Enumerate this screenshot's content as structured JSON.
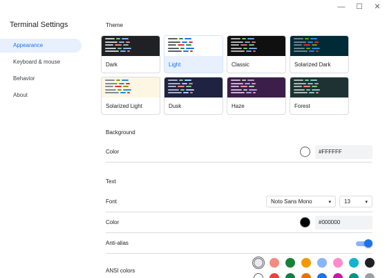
{
  "window": {
    "minimize_glyph": "—",
    "maximize_glyph": "☐",
    "close_glyph": "✕"
  },
  "sidebar": {
    "title": "Terminal Settings",
    "items": [
      {
        "label": "Appearance",
        "active": true
      },
      {
        "label": "Keyboard & mouse",
        "active": false
      },
      {
        "label": "Behavior",
        "active": false
      },
      {
        "label": "About",
        "active": false
      }
    ]
  },
  "theme": {
    "section_title": "Theme",
    "selected": "Light",
    "cards": [
      {
        "label": "Dark",
        "bg": "#202124",
        "fg": "#e8eaed",
        "accents": [
          "#f28b82",
          "#81c995",
          "#8ab4f8"
        ]
      },
      {
        "label": "Light",
        "bg": "#ffffff",
        "fg": "#3c4043",
        "accents": [
          "#d93025",
          "#1e8e3e",
          "#1a73e8"
        ]
      },
      {
        "label": "Classic",
        "bg": "#101010",
        "fg": "#d0d0d0",
        "accents": [
          "#e06c75",
          "#6fcf6f",
          "#6fa8dc"
        ]
      },
      {
        "label": "Solarized Dark",
        "bg": "#002b36",
        "fg": "#839496",
        "accents": [
          "#dc322f",
          "#859900",
          "#268bd2"
        ]
      },
      {
        "label": "Solarized Light",
        "bg": "#fdf6e3",
        "fg": "#657b83",
        "accents": [
          "#dc322f",
          "#859900",
          "#268bd2"
        ]
      },
      {
        "label": "Dusk",
        "bg": "#1f2240",
        "fg": "#c7c9e0",
        "accents": [
          "#f28b82",
          "#81c995",
          "#aecbfa"
        ]
      },
      {
        "label": "Haze",
        "bg": "#3c1e4a",
        "fg": "#e0d0ea",
        "accents": [
          "#f48fb1",
          "#a5d6a7",
          "#b39ddb"
        ]
      },
      {
        "label": "Forest",
        "bg": "#1e3233",
        "fg": "#c5d6d0",
        "accents": [
          "#f28b82",
          "#81c995",
          "#80cbc4"
        ]
      }
    ]
  },
  "background": {
    "section_title": "Background",
    "color_label": "Color",
    "color_value": "#FFFFFF",
    "swatch": "#ffffff"
  },
  "text": {
    "section_title": "Text",
    "font_label": "Font",
    "font_value": "Noto Sans Mono",
    "font_size": "13",
    "color_label": "Color",
    "color_value": "#000000",
    "swatch": "#000000",
    "antialias_label": "Anti-alias",
    "antialias_on": true,
    "ansi_label": "ANSI colors",
    "ansi_row1": [
      "#e8eaed",
      "#f28b82",
      "#188038",
      "#f29900",
      "#8ab4f8",
      "#ff8bcb",
      "#12b5cb",
      "#202124"
    ],
    "ansi_row2": [
      "#ffffff",
      "#ea4335",
      "#0d8043",
      "#e37400",
      "#1a73e8",
      "#c61ba8",
      "#009688",
      "#9aa0a6"
    ]
  },
  "icons": {
    "caret": "▾"
  }
}
